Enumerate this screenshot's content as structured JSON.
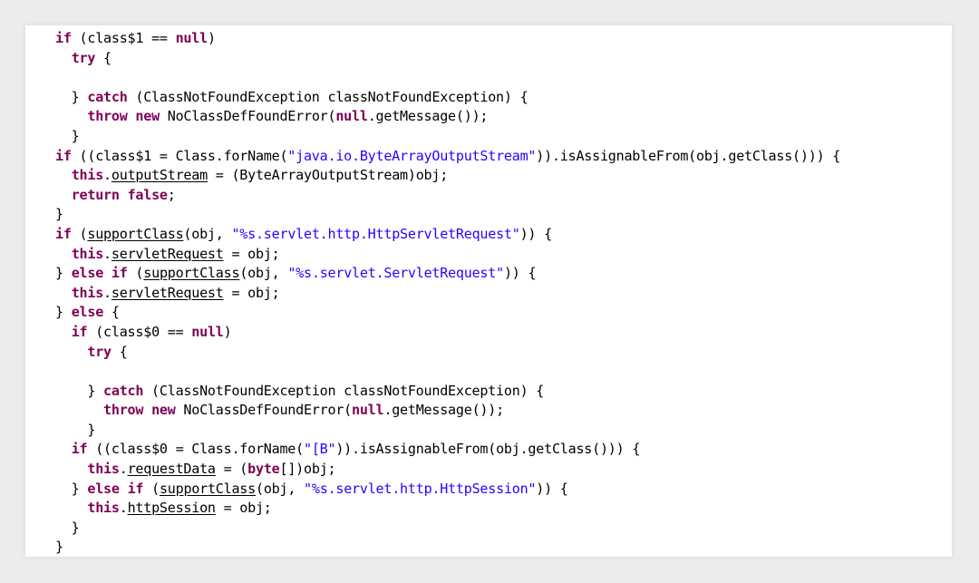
{
  "lines": [
    [
      {
        "t": "if",
        "k": "kw"
      },
      {
        "t": " (class$1 == "
      },
      {
        "t": "null",
        "k": "kw"
      },
      {
        "t": ")"
      }
    ],
    [
      {
        "t": "  "
      },
      {
        "t": "try",
        "k": "kw"
      },
      {
        "t": " {"
      }
    ],
    [],
    [
      {
        "t": "  } "
      },
      {
        "t": "catch",
        "k": "kw"
      },
      {
        "t": " (ClassNotFoundException classNotFoundException) {"
      }
    ],
    [
      {
        "t": "    "
      },
      {
        "t": "throw",
        "k": "kw"
      },
      {
        "t": " "
      },
      {
        "t": "new",
        "k": "kw"
      },
      {
        "t": " NoClassDefFoundError("
      },
      {
        "t": "null",
        "k": "kw"
      },
      {
        "t": ".getMessage());"
      }
    ],
    [
      {
        "t": "  }"
      }
    ],
    [
      {
        "t": "if",
        "k": "kw"
      },
      {
        "t": " ((class$1 = Class.forName("
      },
      {
        "t": "\"java.io.ByteArrayOutputStream\"",
        "k": "str"
      },
      {
        "t": ")).isAssignableFrom(obj.getClass())) {"
      }
    ],
    [
      {
        "t": "  "
      },
      {
        "t": "this",
        "k": "kw"
      },
      {
        "t": "."
      },
      {
        "t": "outputStream",
        "k": "u"
      },
      {
        "t": " = (ByteArrayOutputStream)obj;"
      }
    ],
    [
      {
        "t": "  "
      },
      {
        "t": "return",
        "k": "kw"
      },
      {
        "t": " "
      },
      {
        "t": "false",
        "k": "kw"
      },
      {
        "t": ";"
      }
    ],
    [
      {
        "t": "}"
      }
    ],
    [
      {
        "t": "if",
        "k": "kw"
      },
      {
        "t": " ("
      },
      {
        "t": "supportClass",
        "k": "u"
      },
      {
        "t": "(obj, "
      },
      {
        "t": "\"%s.servlet.http.HttpServletRequest\"",
        "k": "str"
      },
      {
        "t": ")) {"
      }
    ],
    [
      {
        "t": "  "
      },
      {
        "t": "this",
        "k": "kw"
      },
      {
        "t": "."
      },
      {
        "t": "servletRequest",
        "k": "u"
      },
      {
        "t": " = obj;"
      }
    ],
    [
      {
        "t": "} "
      },
      {
        "t": "else",
        "k": "kw"
      },
      {
        "t": " "
      },
      {
        "t": "if",
        "k": "kw"
      },
      {
        "t": " ("
      },
      {
        "t": "supportClass",
        "k": "u"
      },
      {
        "t": "(obj, "
      },
      {
        "t": "\"%s.servlet.ServletRequest\"",
        "k": "str"
      },
      {
        "t": ")) {"
      }
    ],
    [
      {
        "t": "  "
      },
      {
        "t": "this",
        "k": "kw"
      },
      {
        "t": "."
      },
      {
        "t": "servletRequest",
        "k": "u"
      },
      {
        "t": " = obj;"
      }
    ],
    [
      {
        "t": "} "
      },
      {
        "t": "else",
        "k": "kw"
      },
      {
        "t": " {"
      }
    ],
    [
      {
        "t": "  "
      },
      {
        "t": "if",
        "k": "kw"
      },
      {
        "t": " (class$0 == "
      },
      {
        "t": "null",
        "k": "kw"
      },
      {
        "t": ")"
      }
    ],
    [
      {
        "t": "    "
      },
      {
        "t": "try",
        "k": "kw"
      },
      {
        "t": " {"
      }
    ],
    [],
    [
      {
        "t": "    } "
      },
      {
        "t": "catch",
        "k": "kw"
      },
      {
        "t": " (ClassNotFoundException classNotFoundException) {"
      }
    ],
    [
      {
        "t": "      "
      },
      {
        "t": "throw",
        "k": "kw"
      },
      {
        "t": " "
      },
      {
        "t": "new",
        "k": "kw"
      },
      {
        "t": " NoClassDefFoundError("
      },
      {
        "t": "null",
        "k": "kw"
      },
      {
        "t": ".getMessage());"
      }
    ],
    [
      {
        "t": "    }"
      }
    ],
    [
      {
        "t": "  "
      },
      {
        "t": "if",
        "k": "kw"
      },
      {
        "t": " ((class$0 = Class.forName("
      },
      {
        "t": "\"[B\"",
        "k": "str"
      },
      {
        "t": ")).isAssignableFrom(obj.getClass())) {"
      }
    ],
    [
      {
        "t": "    "
      },
      {
        "t": "this",
        "k": "kw"
      },
      {
        "t": "."
      },
      {
        "t": "requestData",
        "k": "u"
      },
      {
        "t": " = ("
      },
      {
        "t": "byte",
        "k": "kw"
      },
      {
        "t": "[])obj;"
      }
    ],
    [
      {
        "t": "  } "
      },
      {
        "t": "else",
        "k": "kw"
      },
      {
        "t": " "
      },
      {
        "t": "if",
        "k": "kw"
      },
      {
        "t": " ("
      },
      {
        "t": "supportClass",
        "k": "u"
      },
      {
        "t": "(obj, "
      },
      {
        "t": "\"%s.servlet.http.HttpSession\"",
        "k": "str"
      },
      {
        "t": ")) {"
      }
    ],
    [
      {
        "t": "    "
      },
      {
        "t": "this",
        "k": "kw"
      },
      {
        "t": "."
      },
      {
        "t": "httpSession",
        "k": "u"
      },
      {
        "t": " = obj;"
      }
    ],
    [
      {
        "t": "  }"
      }
    ],
    [
      {
        "t": "}"
      }
    ]
  ],
  "colors": {
    "keyword": "#7f0055",
    "string": "#2a00ff",
    "text": "#000000",
    "background": "#ffffff"
  }
}
